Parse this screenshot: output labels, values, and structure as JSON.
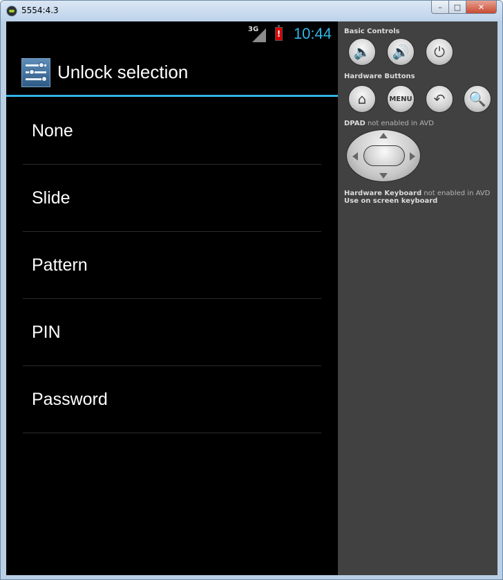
{
  "window": {
    "title": "5554:4.3",
    "min_label": "–",
    "max_label": "□",
    "close_label": "✕"
  },
  "statusbar": {
    "network": "3G",
    "time": "10:44"
  },
  "actionbar": {
    "title": "Unlock selection",
    "icon": "settings-sliders-icon"
  },
  "list": {
    "items": [
      "None",
      "Slide",
      "Pattern",
      "PIN",
      "Password"
    ]
  },
  "controls": {
    "basic_controls_label": "Basic Controls",
    "hardware_buttons_label": "Hardware Buttons",
    "menu_label": "MENU",
    "dpad_label": "DPAD",
    "dpad_note": " not enabled in AVD",
    "keyboard_label": "Hardware Keyboard",
    "keyboard_note": " not enabled in AVD",
    "onscreen_keyboard": "Use on screen keyboard",
    "icons": {
      "volume_down": "🔈",
      "volume_up": "🔊",
      "power": "⏻",
      "home": "⌂",
      "back": "↶",
      "search": "🔍"
    }
  },
  "colors": {
    "accent": "#33b5e5",
    "screen_bg": "#000000",
    "controls_bg": "#414141",
    "battery_alert": "#d40000"
  }
}
